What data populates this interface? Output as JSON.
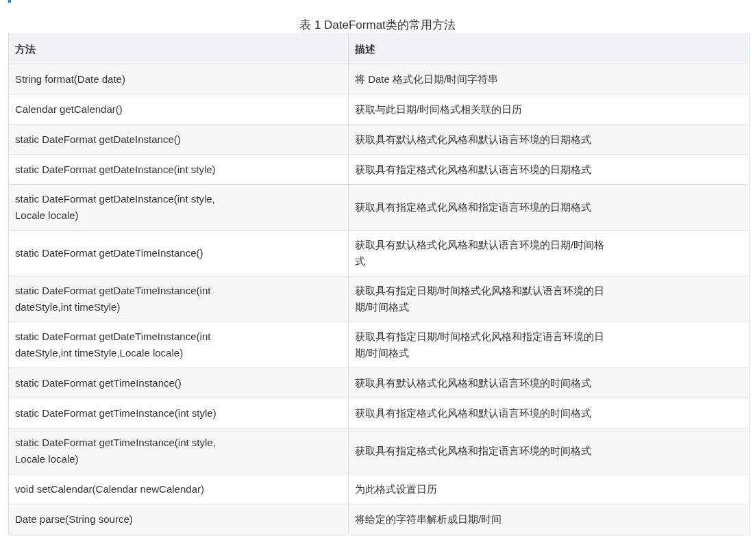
{
  "caption": "表 1 DateFormat类的常用方法",
  "table": {
    "columns": [
      "方法",
      "描述"
    ],
    "rows": [
      [
        "String format(Date date)",
        "将 Date 格式化日期/时间字符串"
      ],
      [
        "Calendar getCalendar()",
        "获取与此日期/时间格式相关联的日历"
      ],
      [
        "static DateFormat getDateInstance()",
        "获取具有默认格式化风格和默认语言环境的日期格式"
      ],
      [
        "static DateFormat getDateInstance(int style)",
        "获取具有指定格式化风格和默认语言环境的日期格式"
      ],
      [
        "static DateFormat getDateInstance(int style, Locale locale)",
        "获取具有指定格式化风格和指定语言环境的日期格式"
      ],
      [
        "static DateFormat getDateTimeInstance()",
        "获取具有默认格式化风格和默认语言环境的日期/时间格式"
      ],
      [
        "static DateFormat getDateTimeInstance(int dateStyle,int timeStyle)",
        "获取具有指定日期/时间格式化风格和默认语言环境的日期/时间格式"
      ],
      [
        "static DateFormat getDateTimeInstance(int dateStyle,int timeStyle,Locale locale)",
        "获取具有指定日期/时间格式化风格和指定语言环境的日期/时间格式"
      ],
      [
        "static DateFormat getTimeInstance()",
        "获取具有默认格式化风格和默认语言环境的时间格式"
      ],
      [
        "static DateFormat getTimeInstance(int style)",
        "获取具有指定格式化风格和默认语言环境的时间格式"
      ],
      [
        "static DateFormat getTimeInstance(int style, Locale locale)",
        "获取具有指定格式化风格和指定语言环境的时间格式"
      ],
      [
        "void setCalendar(Calendar newCalendar)",
        "为此格式设置日历"
      ],
      [
        "Date parse(String source)",
        "将给定的字符串解析成日期/时间"
      ]
    ]
  }
}
